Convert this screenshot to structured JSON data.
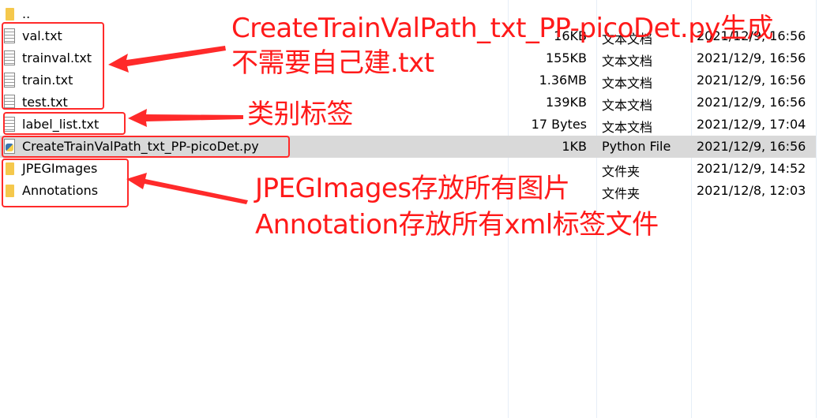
{
  "files": [
    {
      "name": "..",
      "icon": "folder-icon",
      "size": "",
      "type": "",
      "date": ""
    },
    {
      "name": "val.txt",
      "icon": "file-icon",
      "size": "16KB",
      "type": "文本文档",
      "date": "2021/12/9, 16:56"
    },
    {
      "name": "trainval.txt",
      "icon": "file-icon",
      "size": "155KB",
      "type": "文本文档",
      "date": "2021/12/9, 16:56"
    },
    {
      "name": "train.txt",
      "icon": "file-icon",
      "size": "1.36MB",
      "type": "文本文档",
      "date": "2021/12/9, 16:56"
    },
    {
      "name": "test.txt",
      "icon": "file-icon",
      "size": "139KB",
      "type": "文本文档",
      "date": "2021/12/9, 16:56"
    },
    {
      "name": "label_list.txt",
      "icon": "file-icon",
      "size": "17 Bytes",
      "type": "文本文档",
      "date": "2021/12/9, 17:04"
    },
    {
      "name": "CreateTrainValPath_txt_PP-picoDet.py",
      "icon": "python-file-icon",
      "size": "1KB",
      "type": "Python File",
      "date": "2021/12/9, 16:56",
      "selected": true
    },
    {
      "name": "JPEGImages",
      "icon": "folder-icon",
      "size": "",
      "type": "文件夹",
      "date": "2021/12/9, 14:52"
    },
    {
      "name": "Annotations",
      "icon": "folder-icon",
      "size": "",
      "type": "文件夹",
      "date": "2021/12/8, 12:03"
    }
  ],
  "annotations": {
    "split_files_line1": "CreateTrainValPath_txt_PP-picoDet.py生成",
    "split_files_line2": "不需要自己建.txt",
    "label_list": "类别标签",
    "folders_line1": "JPEGImages存放所有图片",
    "folders_line2": "Annotation存放所有xml标签文件"
  },
  "colors": {
    "annotation": "#ff1a1a",
    "selected_row": "#d9d9d9"
  }
}
